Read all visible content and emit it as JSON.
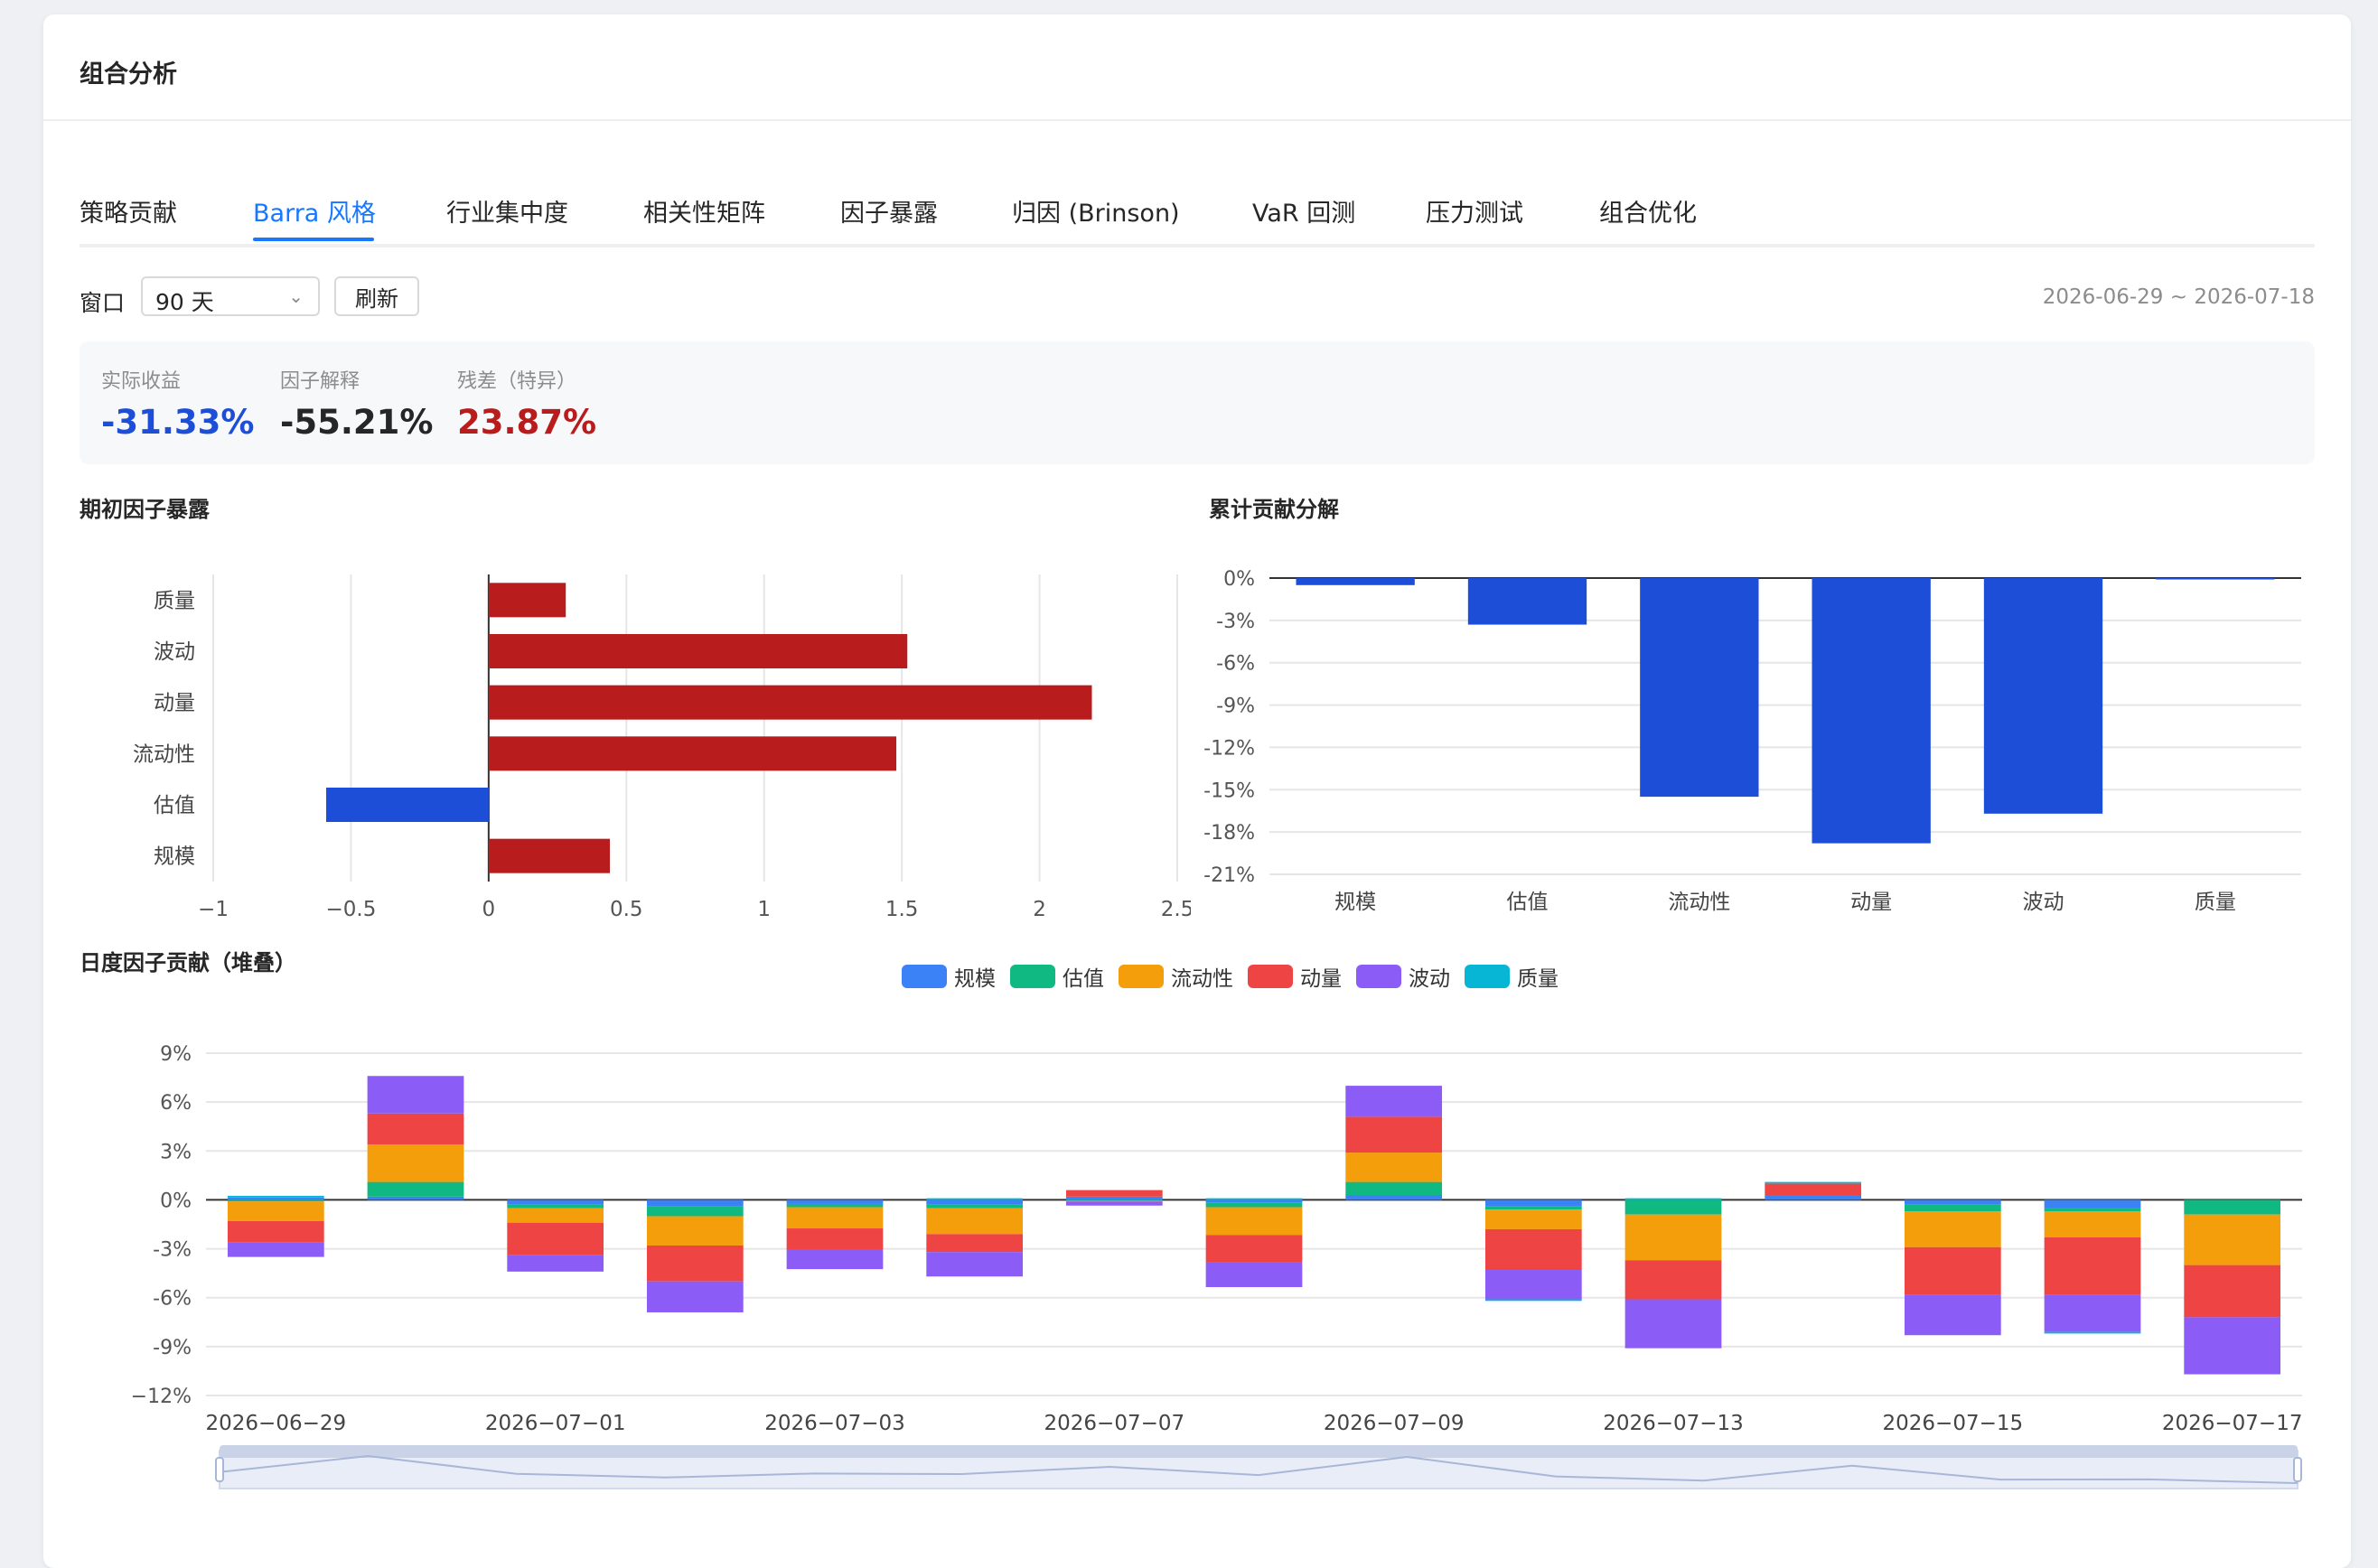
{
  "page_title": "组合分析",
  "tabs": [
    "策略贡献",
    "Barra 风格",
    "行业集中度",
    "相关性矩阵",
    "因子暴露",
    "归因 (Brinson)",
    "VaR 回测",
    "压力测试",
    "组合优化"
  ],
  "active_tab": "Barra 风格",
  "toolbar": {
    "window_label": "窗口",
    "window_value": "90 天",
    "refresh_label": "刷新",
    "date_range": "2026-06-29 ~ 2026-07-18"
  },
  "stats": [
    {
      "label": "实际收益",
      "value": "-31.33%",
      "color": "#1d4ed8"
    },
    {
      "label": "因子解释",
      "value": "-55.21%",
      "color": "#262626"
    },
    {
      "label": "残差（特异）",
      "value": "23.87%",
      "color": "#b91c1c"
    }
  ],
  "colors": {
    "positive": "#b91c1c",
    "negative": "#1d4ed8",
    "accent": "#1677ff"
  },
  "chart_data": [
    {
      "title": "期初因子暴露",
      "type": "bar",
      "orientation": "horizontal",
      "categories": [
        "质量",
        "波动",
        "动量",
        "流动性",
        "估值",
        "规模"
      ],
      "values": [
        0.28,
        1.52,
        2.19,
        1.48,
        -0.59,
        0.44
      ],
      "xlim": [
        -1,
        2.5
      ],
      "xticks": [
        "−1",
        "−0.5",
        "0",
        "0.5",
        "1",
        "1.5",
        "2",
        "2.5"
      ]
    },
    {
      "title": "累计贡献分解",
      "type": "bar",
      "categories": [
        "规模",
        "估值",
        "流动性",
        "动量",
        "波动",
        "质量"
      ],
      "values": [
        -0.5,
        -3.3,
        -15.5,
        -18.8,
        -16.7,
        -0.1
      ],
      "ylim": [
        -21,
        0
      ],
      "yticks": [
        "0%",
        "-3%",
        "-6%",
        "-9%",
        "-12%",
        "-15%",
        "-18%",
        "-21%"
      ]
    },
    {
      "title": "日度因子贡献（堆叠）",
      "type": "bar",
      "stacked": true,
      "categories": [
        "2026-06-29",
        "2026-06-30",
        "2026-07-01",
        "2026-07-02",
        "2026-07-03",
        "2026-07-06",
        "2026-07-07",
        "2026-07-08",
        "2026-07-09",
        "2026-07-10",
        "2026-07-13",
        "2026-07-14",
        "2026-07-15",
        "2026-07-16",
        "2026-07-17"
      ],
      "xtick_labels": [
        "2026−06−29",
        "2026−07−01",
        "2026−07−03",
        "2026−07−07",
        "2026−07−09",
        "2026−07−13",
        "2026−07−15",
        "2026−07−17"
      ],
      "ylim": [
        -12,
        9
      ],
      "yticks": [
        "9%",
        "6%",
        "3%",
        "0%",
        "-3%",
        "-6%",
        "-9%",
        "−12%"
      ],
      "legend_position": "top-center",
      "series": [
        {
          "name": "规模",
          "color": "#3b82f6",
          "values": [
            0.15,
            0.2,
            -0.3,
            -0.4,
            -0.25,
            -0.3,
            0.2,
            -0.15,
            0.3,
            -0.4,
            0.0,
            0.3,
            -0.3,
            -0.5,
            0.0
          ]
        },
        {
          "name": "估值",
          "color": "#10b981",
          "values": [
            -0.1,
            0.9,
            -0.2,
            -0.6,
            -0.2,
            -0.2,
            -0.05,
            -0.3,
            0.8,
            -0.2,
            -0.9,
            0.0,
            -0.4,
            -0.2,
            -0.9
          ]
        },
        {
          "name": "流动性",
          "color": "#f59e0b",
          "values": [
            -1.2,
            2.3,
            -0.9,
            -1.8,
            -1.3,
            -1.6,
            -0.05,
            -1.7,
            1.8,
            -1.2,
            -2.8,
            0.0,
            -2.2,
            -1.6,
            -3.1
          ]
        },
        {
          "name": "动量",
          "color": "#ef4444",
          "values": [
            -1.3,
            1.9,
            -2.0,
            -2.2,
            -1.3,
            -1.1,
            0.4,
            -1.7,
            2.2,
            -2.5,
            -2.4,
            0.7,
            -2.9,
            -3.5,
            -3.2
          ]
        },
        {
          "name": "波动",
          "color": "#8b5cf6",
          "values": [
            -0.9,
            2.3,
            -1.0,
            -1.9,
            -1.2,
            -1.5,
            -0.25,
            -1.5,
            1.9,
            -1.8,
            -3.0,
            0.0,
            -2.5,
            -2.3,
            -3.5
          ]
        },
        {
          "name": "质量",
          "color": "#06b6d4",
          "values": [
            0.1,
            0.0,
            0.0,
            0.0,
            0.0,
            0.1,
            0.0,
            0.1,
            0.0,
            -0.1,
            0.1,
            0.1,
            0.0,
            -0.1,
            0.0
          ]
        }
      ]
    }
  ]
}
